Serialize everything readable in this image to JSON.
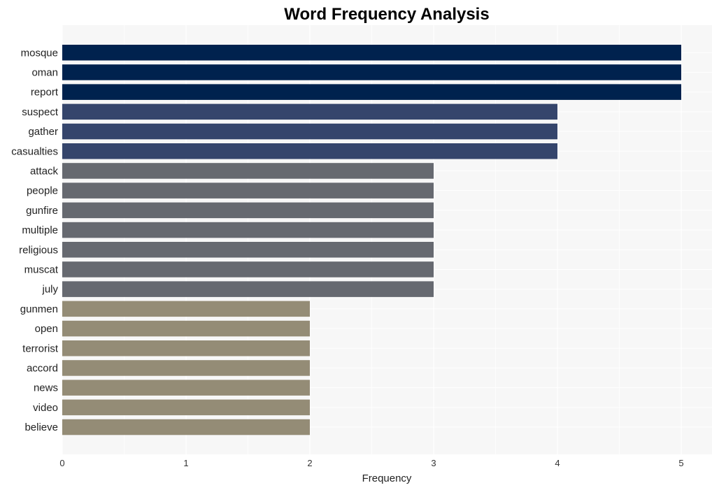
{
  "chart_data": {
    "type": "bar",
    "orientation": "horizontal",
    "title": "Word Frequency Analysis",
    "xlabel": "Frequency",
    "ylabel": "",
    "xlim": [
      0,
      5.25
    ],
    "xticks": [
      0,
      1,
      2,
      3,
      4,
      5
    ],
    "grid": true,
    "legend": "none",
    "categories": [
      "mosque",
      "oman",
      "report",
      "suspect",
      "gather",
      "casualties",
      "attack",
      "people",
      "gunfire",
      "multiple",
      "religious",
      "muscat",
      "july",
      "gunmen",
      "open",
      "terrorist",
      "accord",
      "news",
      "video",
      "believe"
    ],
    "values": [
      5,
      5,
      5,
      4,
      4,
      4,
      3,
      3,
      3,
      3,
      3,
      3,
      3,
      2,
      2,
      2,
      2,
      2,
      2,
      2
    ],
    "colors_by_value": {
      "5": "#00224e",
      "4": "#35456c",
      "3": "#666970",
      "2": "#948c76"
    }
  }
}
